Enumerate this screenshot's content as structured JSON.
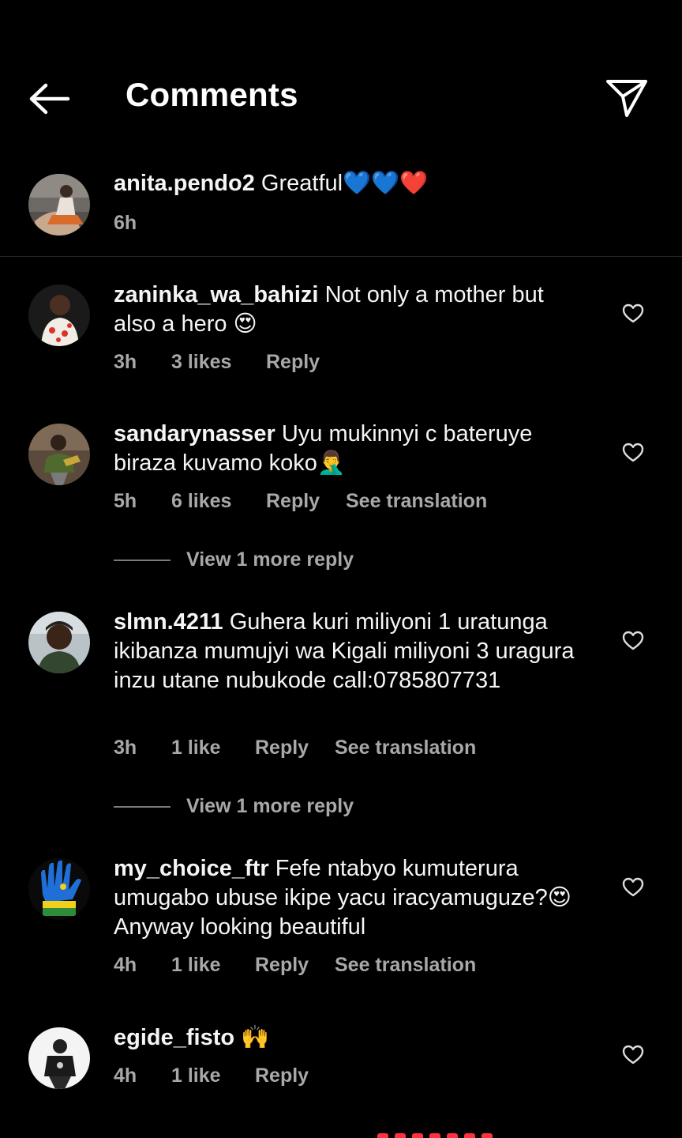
{
  "header": {
    "title": "Comments"
  },
  "caption": {
    "username": "anita.pendo2",
    "text": "Greatful💙💙❤️",
    "time": "6h"
  },
  "comments": [
    {
      "username": "zaninka_wa_bahizi",
      "text": "Not only a mother but also a hero 😍",
      "time": "3h",
      "likes": "3 likes",
      "reply": "Reply"
    },
    {
      "username": "sandarynasser",
      "text": "Uyu mukinnyi c bateruye biraza kuvamo koko🤦‍♂️",
      "time": "5h",
      "likes": "6 likes",
      "reply": "Reply",
      "translate": "See translation",
      "view_more": "View 1 more reply"
    },
    {
      "username": "slmn.4211",
      "text": "Guhera kuri miliyoni 1 uratunga ikibanza mumujyi wa Kigali miliyoni 3 uragura inzu utane nubukode call:0785807731",
      "time": "3h",
      "likes": "1 like",
      "reply": "Reply",
      "translate": "See translation",
      "view_more": "View 1 more reply"
    },
    {
      "username": "my_choice_ftr",
      "text": "Fefe ntabyo kumuterura umugabo ubuse ikipe yacu iracyamuguze?😍Anyway looking beautiful",
      "time": "4h",
      "likes": "1 like",
      "reply": "Reply",
      "translate": "See translation"
    },
    {
      "username": "egide_fisto",
      "text": "🙌",
      "time": "4h",
      "likes": "1 like",
      "reply": "Reply"
    }
  ],
  "icons": {
    "back": "arrow-left-icon",
    "share": "paper-plane-icon",
    "like": "heart-outline-icon"
  },
  "colors": {
    "background": "#000000",
    "text": "#f5f5f5",
    "secondary": "#a8a8a8",
    "divider": "#262626"
  }
}
